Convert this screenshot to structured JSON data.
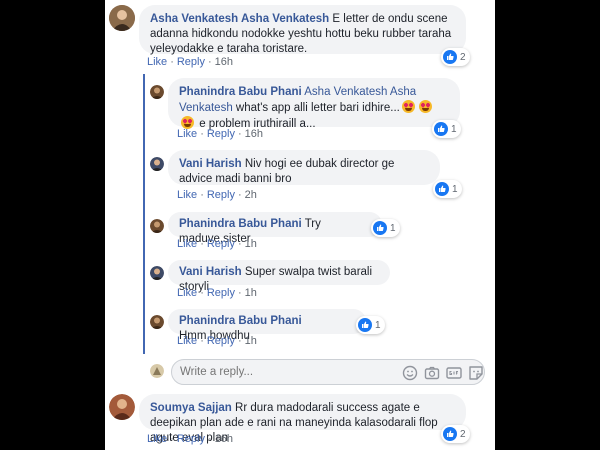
{
  "comments": [
    {
      "author": "Asha Venkatesh Asha Venkatesh",
      "text": "E letter de ondu scene adanna hidkondu nodokke yeshtu hottu beku rubber taraha yeleyodakke e taraha toristare.",
      "like": "Like",
      "reply": "Reply",
      "time": "16h",
      "reactions": "2"
    },
    {
      "author": "Phanindra Babu Phani",
      "mention": "Asha Venkatesh Asha Venkatesh",
      "text_before": "what's app alli letter bari idhire...",
      "text_after": "e problem iruthiraill a...",
      "like": "Like",
      "reply": "Reply",
      "time": "16h",
      "reactions": "1"
    },
    {
      "author": "Vani Harish",
      "text": "Niv hogi ee dubak director ge advice madi banni bro",
      "like": "Like",
      "reply": "Reply",
      "time": "2h",
      "reactions": "1"
    },
    {
      "author": "Phanindra Babu Phani",
      "text": "Try maduve,sister",
      "like": "Like",
      "reply": "Reply",
      "time": "1h",
      "reactions": "1"
    },
    {
      "author": "Vani Harish",
      "text": "Super swalpa twist barali storyli",
      "like": "Like",
      "reply": "Reply",
      "time": "1h"
    },
    {
      "author": "Phanindra Babu Phani",
      "text": "Hmm,howdhu",
      "like": "Like",
      "reply": "Reply",
      "time": "1h",
      "reactions": "1"
    },
    {
      "author": "Soumya Sajjan",
      "text": "Rr dura madodarali success agate e deepikan plan ade e rani na maneyinda kalasodarali flop agute eval plan",
      "like": "Like",
      "reply": "Reply",
      "time": "16h",
      "reactions": "2"
    }
  ],
  "reply_box": {
    "placeholder": "Write a reply..."
  },
  "colors": {
    "author": "#385898",
    "link": "#4267b2",
    "bubble": "#f2f3f5",
    "like_badge": "#1877f2"
  },
  "icons": [
    "like-icon",
    "love-eyes-emoji",
    "smiley-icon",
    "camera-icon",
    "gif-icon",
    "sticker-icon"
  ]
}
